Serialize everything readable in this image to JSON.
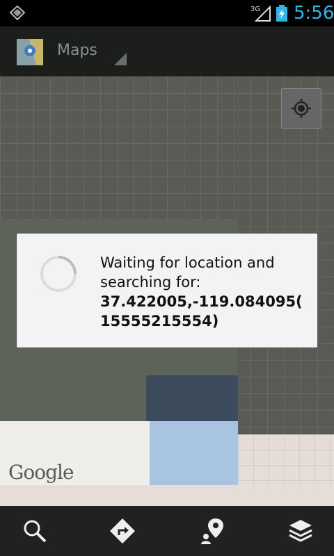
{
  "status_bar": {
    "network": "3G",
    "time": "5:56",
    "accent_color": "#33b5e5"
  },
  "action_bar": {
    "title": "Maps",
    "app_icon": "maps-app-icon"
  },
  "map": {
    "attribution": "Google",
    "locate_icon": "my-location-icon"
  },
  "dialog": {
    "message": "Waiting for location and searching for:",
    "query_line1": "37.422005,-119.084095(",
    "query_line2": "15555215554)"
  },
  "bottom_bar": {
    "icons": [
      "search-icon",
      "directions-icon",
      "places-icon",
      "layers-icon"
    ]
  }
}
